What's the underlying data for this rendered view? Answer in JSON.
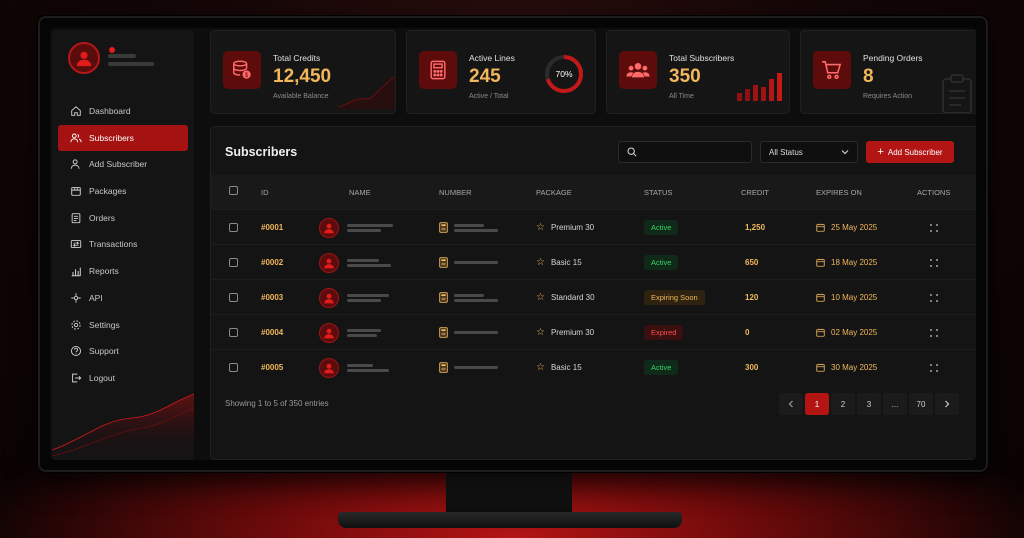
{
  "colors": {
    "accent": "#b31515",
    "gold": "#f2b75b",
    "active_green": "#39d36b",
    "expired_red": "#ff4b4b"
  },
  "sidebar": {
    "items": [
      {
        "label": "Dashboard",
        "icon": "home-icon"
      },
      {
        "label": "Subscribers",
        "icon": "users-icon",
        "active": true
      },
      {
        "label": "Add Subscriber",
        "icon": "user-plus-icon"
      },
      {
        "label": "Packages",
        "icon": "package-icon"
      },
      {
        "label": "Orders",
        "icon": "orders-icon"
      },
      {
        "label": "Transactions",
        "icon": "transactions-icon"
      },
      {
        "label": "Reports",
        "icon": "chart-icon"
      },
      {
        "label": "API",
        "icon": "api-icon"
      },
      {
        "label": "Settings",
        "icon": "gear-icon"
      },
      {
        "label": "Support",
        "icon": "support-icon"
      },
      {
        "label": "Logout",
        "icon": "logout-icon"
      }
    ]
  },
  "cards": [
    {
      "label": "Total Credits",
      "value": "12,450",
      "sub": "Available Balance",
      "icon": "database-coin-icon"
    },
    {
      "label": "Active Lines",
      "value": "245",
      "sub": "Active / Total",
      "icon": "calculator-icon",
      "ring": "70%"
    },
    {
      "label": "Total Subscribers",
      "value": "350",
      "sub": "All Time",
      "icon": "group-icon"
    },
    {
      "label": "Pending Orders",
      "value": "8",
      "sub": "Requires Action",
      "icon": "cart-icon"
    }
  ],
  "panel": {
    "title": "Subscribers",
    "search_placeholder": "",
    "status_select": "All Status",
    "add_button": "Add Subscriber",
    "columns": [
      "ID",
      "NAME",
      "NUMBER",
      "PACKAGE",
      "STATUS",
      "CREDIT",
      "EXPIRES ON",
      "ACTIONS"
    ],
    "rows": [
      {
        "id": "#0001",
        "package": "Premium 30",
        "status": "Active",
        "status_type": "active",
        "credit": "1,250",
        "expires": "25 May 2025"
      },
      {
        "id": "#0002",
        "package": "Basic 15",
        "status": "Active",
        "status_type": "active",
        "credit": "650",
        "expires": "18 May 2025"
      },
      {
        "id": "#0003",
        "package": "Standard 30",
        "status": "Expiring Soon",
        "status_type": "soon",
        "credit": "120",
        "expires": "10 May 2025"
      },
      {
        "id": "#0004",
        "package": "Premium 30",
        "status": "Expired",
        "status_type": "expired",
        "credit": "0",
        "expires": "02 May 2025"
      },
      {
        "id": "#0005",
        "package": "Basic 15",
        "status": "Active",
        "status_type": "active",
        "credit": "300",
        "expires": "30 May 2025"
      }
    ],
    "footer": "Showing 1 to 5 of 350 entries",
    "pagination": [
      "1",
      "2",
      "3",
      "...",
      "70"
    ],
    "current_page": "1"
  }
}
